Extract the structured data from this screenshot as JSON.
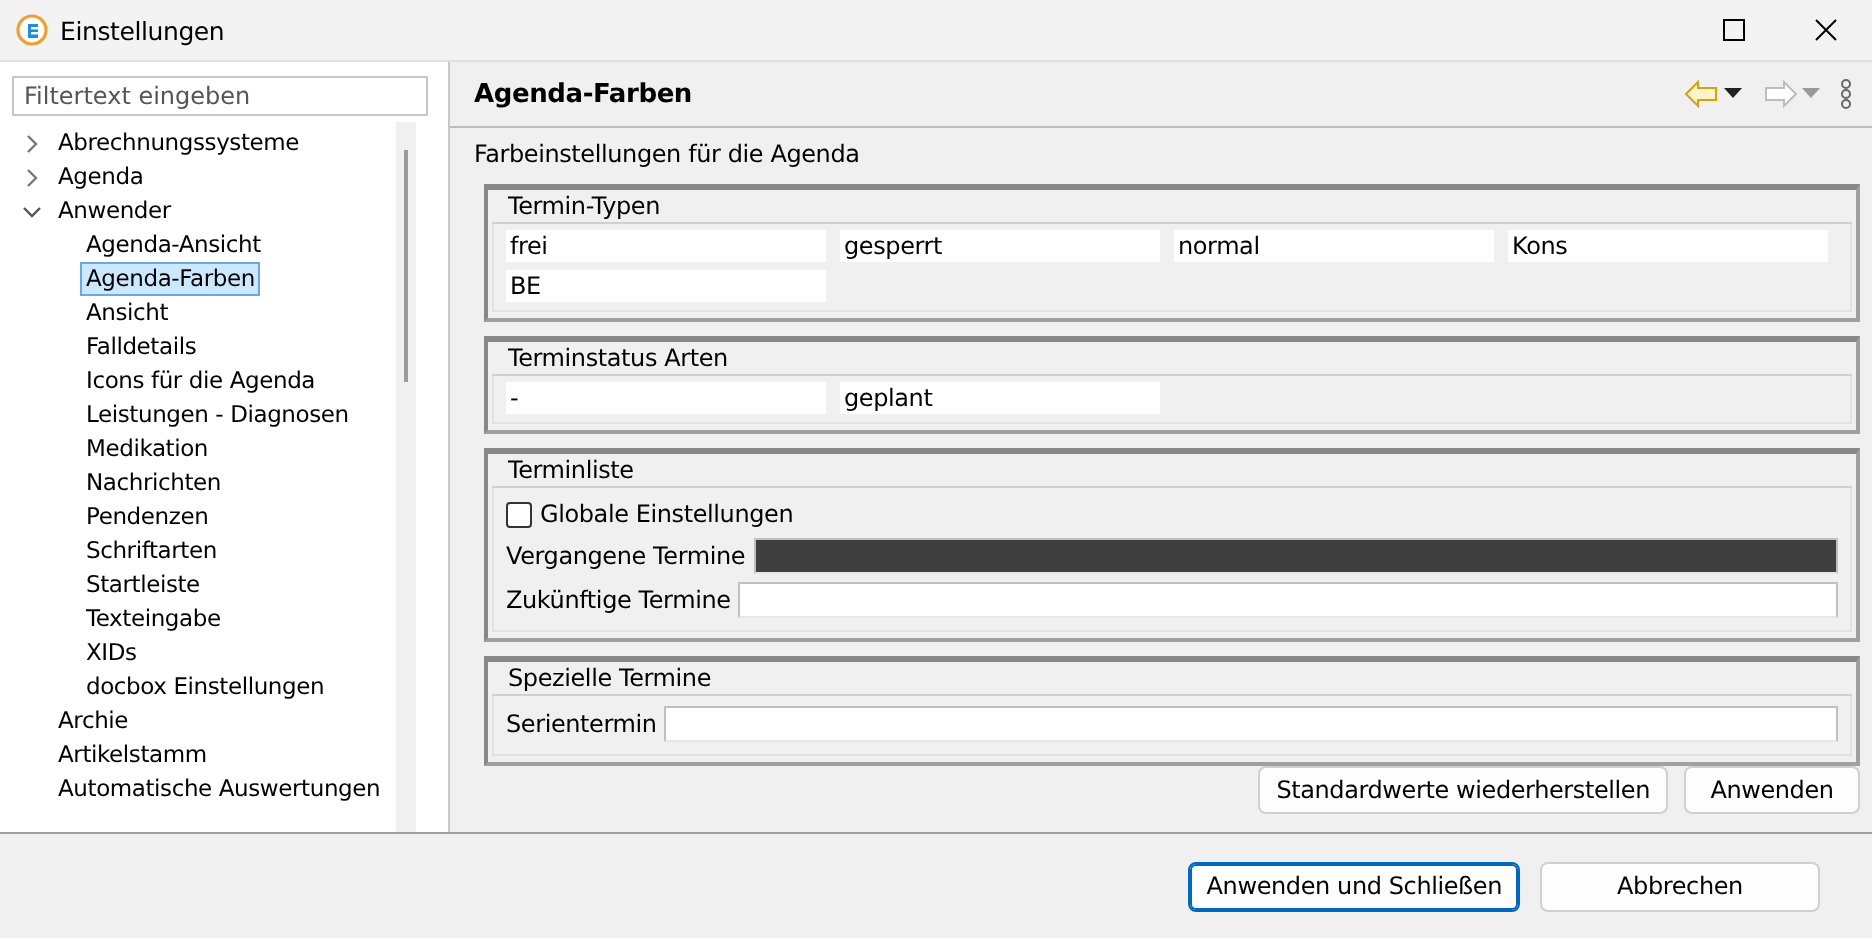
{
  "window": {
    "title": "Einstellungen"
  },
  "sidebar": {
    "filter": {
      "placeholder": "Filtertext eingeben"
    },
    "items": [
      {
        "label": "Abrechnungssysteme",
        "expanded": false,
        "selected": false
      },
      {
        "label": "Agenda",
        "expanded": false,
        "selected": false
      },
      {
        "label": "Anwender",
        "expanded": true,
        "selected": false,
        "children": [
          {
            "label": "Agenda-Ansicht",
            "selected": false
          },
          {
            "label": "Agenda-Farben",
            "selected": true
          },
          {
            "label": "Ansicht",
            "selected": false
          },
          {
            "label": "Falldetails",
            "selected": false
          },
          {
            "label": "Icons für die Agenda",
            "selected": false
          },
          {
            "label": "Leistungen - Diagnosen",
            "selected": false
          },
          {
            "label": "Medikation",
            "selected": false
          },
          {
            "label": "Nachrichten",
            "selected": false
          },
          {
            "label": "Pendenzen",
            "selected": false
          },
          {
            "label": "Schriftarten",
            "selected": false
          },
          {
            "label": "Startleiste",
            "selected": false
          },
          {
            "label": "Texteingabe",
            "selected": false
          },
          {
            "label": "XIDs",
            "selected": false
          },
          {
            "label": "docbox Einstellungen",
            "selected": false
          }
        ]
      },
      {
        "label": "Archie",
        "selected": false
      },
      {
        "label": "Artikelstamm",
        "selected": false
      },
      {
        "label": "Automatische Auswertungen",
        "selected": false
      }
    ]
  },
  "page": {
    "title": "Agenda-Farben",
    "description": "Farbeinstellungen für die Agenda",
    "groups": [
      {
        "title": "Termin-Typen",
        "kind": "swatches",
        "items": [
          {
            "label": "frei",
            "color": "#ffffff"
          },
          {
            "label": "gesperrt",
            "color": "#ffffff"
          },
          {
            "label": "normal",
            "color": "#ffffff"
          },
          {
            "label": "Kons",
            "color": "#ffffff"
          },
          {
            "label": "BE",
            "color": "#ffffff"
          }
        ]
      },
      {
        "title": "Terminstatus Arten",
        "kind": "swatches",
        "items": [
          {
            "label": "-",
            "color": "#ffffff"
          },
          {
            "label": "geplant",
            "color": "#ffffff"
          }
        ]
      },
      {
        "title": "Terminliste",
        "kind": "rows",
        "items": [
          {
            "kind": "checkbox",
            "label": "Globale Einstellungen",
            "checked": false
          },
          {
            "kind": "color",
            "label": "Vergangene Termine",
            "color": "#3f3f3f"
          },
          {
            "kind": "color",
            "label": "Zukünftige Termine",
            "color": "#ffffff"
          }
        ]
      },
      {
        "title": "Spezielle Termine",
        "kind": "rows",
        "items": [
          {
            "kind": "color",
            "label": "Serientermin",
            "color": "#ffffff"
          }
        ]
      }
    ],
    "buttons": [
      "Standardwerte wiederherstellen",
      "Anwenden"
    ]
  },
  "footer": {
    "buttons": [
      {
        "label": "Anwenden und Schließen",
        "default": true
      },
      {
        "label": "Abbrechen",
        "default": false
      }
    ]
  }
}
